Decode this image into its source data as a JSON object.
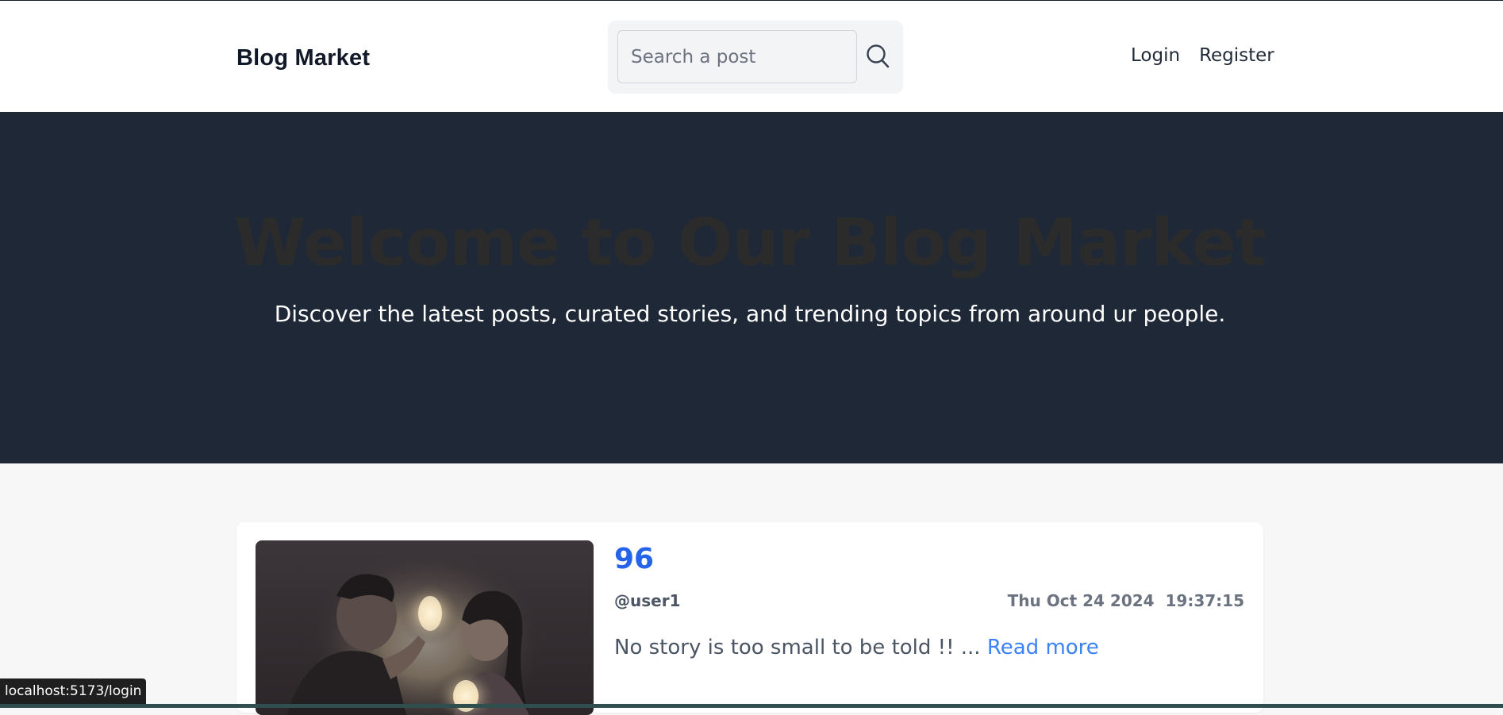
{
  "header": {
    "brand": "Blog Market",
    "search": {
      "placeholder": "Search a post",
      "value": ""
    },
    "nav": [
      {
        "label": "Login"
      },
      {
        "label": "Register"
      }
    ]
  },
  "hero": {
    "title": "Welcome to Our Blog Market",
    "subtitle": "Discover the latest posts, curated stories, and trending topics from around ur people."
  },
  "posts": [
    {
      "title": "96",
      "author": "@user1",
      "date": "Thu Oct 24 2024  19:37:15",
      "excerpt": "No story is too small to be told !! ...",
      "read_more": "Read more"
    }
  ],
  "status_bar": {
    "url": "localhost:5173/login"
  },
  "colors": {
    "hero_bg": "#1f2837",
    "link_blue": "#2563eb",
    "page_bg": "#f7f7f7"
  }
}
